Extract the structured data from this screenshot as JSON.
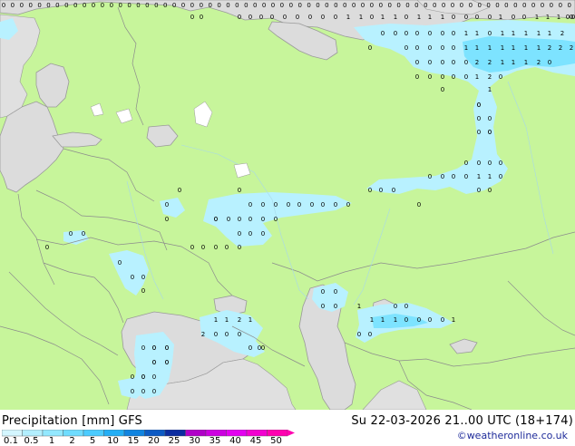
{
  "map": {
    "colors": {
      "land": "#c7f59b",
      "land_outside": "#e0e0e0",
      "sea": "#dcdcdc",
      "precip_light": "#b8f1ff",
      "precip_medium": "#7de3ff",
      "border": "#8c8c8c",
      "coast": "#9a9a9a"
    },
    "grid_values": [
      [
        "0",
        "0",
        "0",
        "0",
        "0",
        "0",
        "0",
        "0",
        "0",
        "0",
        "0",
        "0",
        "0",
        "0",
        "0",
        "0",
        "0",
        "0",
        "0",
        "0",
        "0",
        "0",
        "0",
        "0",
        "0",
        "0",
        "0",
        "0",
        "0",
        "0",
        "0",
        "0",
        "0",
        "0",
        "0",
        "0",
        "0",
        "0",
        "0",
        "0",
        "0",
        "0",
        "0",
        "0",
        "0",
        "0",
        "0",
        "0",
        "0",
        "0",
        "0",
        "0",
        "0",
        "0",
        "0",
        "0",
        "0",
        "0",
        "0",
        "0",
        "0",
        "0",
        "0",
        "0"
      ],
      [
        "0",
        "0",
        "0",
        "0",
        "0",
        "0",
        "0",
        "0",
        "0",
        "0",
        "0",
        "1",
        "1",
        "0",
        "1",
        "1",
        "0",
        "1",
        "1",
        "1",
        "0",
        "0",
        "0",
        "0",
        "1",
        "0",
        "0",
        "1",
        "1",
        "1",
        "0",
        "0",
        "0"
      ],
      [
        "0",
        "0",
        "0",
        "0",
        "0",
        "0",
        "0",
        "1",
        "1",
        "0",
        "1",
        "1",
        "1",
        "1",
        "1",
        "2",
        "2"
      ],
      [
        "0",
        "0",
        "0",
        "0",
        "0",
        "0",
        "1",
        "1",
        "1",
        "1",
        "1",
        "1",
        "1",
        "2",
        "2",
        "2"
      ],
      [
        "0",
        "0",
        "0",
        "0",
        "0",
        "2",
        "2",
        "1",
        "1",
        "1",
        "2",
        "0"
      ],
      [
        "0",
        "0",
        "0",
        "0",
        "0",
        "1",
        "2",
        "0"
      ],
      [
        "0",
        "1"
      ],
      [
        "0",
        "0",
        "0",
        "0",
        "0",
        "0",
        "0"
      ],
      [
        "0",
        "0",
        "0",
        "0"
      ],
      [
        "0",
        "0",
        "0",
        "0",
        "1",
        "1",
        "0"
      ],
      [
        "0",
        "0",
        "0",
        "0",
        "0",
        "0",
        "0",
        "0",
        "0",
        "0",
        "0",
        "0",
        "0",
        "0",
        "0",
        "0",
        "0",
        "0",
        "0",
        "0"
      ],
      [
        "0",
        "0",
        "0",
        "0",
        "0",
        "0",
        "0",
        "0",
        "0",
        "0",
        "0",
        "0",
        "0",
        "0",
        "0",
        "0",
        "0",
        "0",
        "0",
        "0",
        "0"
      ],
      [
        "0",
        "0",
        "0",
        "0",
        "1",
        "0",
        "0",
        "1",
        "1",
        "1",
        "0",
        "0",
        "0",
        "0",
        "1",
        "1",
        "1",
        "2",
        "1",
        "2",
        "0",
        "0",
        "0"
      ],
      [
        "0",
        "0",
        "0",
        "0",
        "0",
        "0",
        "0",
        "0",
        "0",
        "0",
        "0",
        "0",
        "0",
        "0",
        "0",
        "0",
        "0",
        "0",
        "0",
        "0",
        "0"
      ]
    ]
  },
  "footer": {
    "title_left": "Precipitation [mm]  GFS",
    "title_right": "Su 22-03-2026 21..00 UTC (18+174)",
    "credit": "©weatheronline.co.uk",
    "legend": {
      "labels": [
        "0.1",
        "0.5",
        "1",
        "2",
        "5",
        "10",
        "15",
        "20",
        "25",
        "30",
        "35",
        "40",
        "45",
        "50"
      ],
      "colors": [
        "#d4f6ff",
        "#b3efff",
        "#93e8ff",
        "#6fdcff",
        "#4bcbff",
        "#23aef5",
        "#1084e0",
        "#0c5ac4",
        "#0b2ca0",
        "#b000c8",
        "#cc00e0",
        "#e300f0",
        "#f200d0",
        "#ff00b0"
      ]
    }
  }
}
